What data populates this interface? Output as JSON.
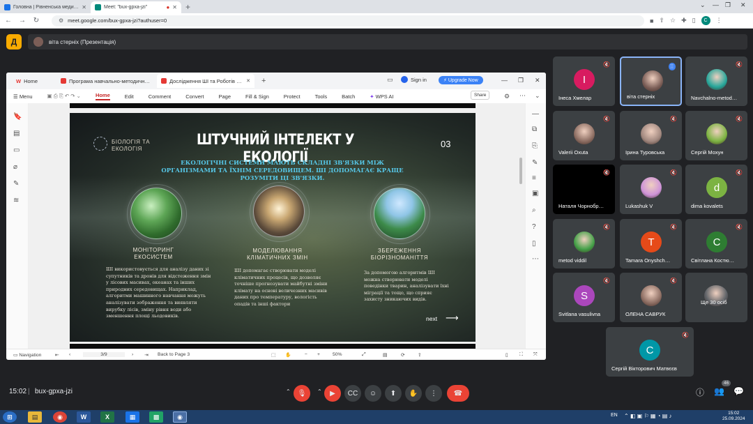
{
  "browser": {
    "tabs": [
      {
        "title": "Головна | Рівненська медична ака…",
        "favicon_color": "#1a73e8"
      },
      {
        "title": "Meet: \"bux-gpxa-jzi\"",
        "favicon_color": "#00897b"
      }
    ],
    "new_tab": "+",
    "url": "meet.google.com/bux-gpxa-jzi?authuser=0",
    "profile_initial": "C"
  },
  "meet": {
    "logo_letter": "Д",
    "presenter_label": "віта стерніх (Презентація)",
    "time": "15:02",
    "meeting_code": "bux-gpxa-jzi",
    "participant_count": "46",
    "participants": [
      {
        "name": "Інеса Хмелар",
        "initial": "І",
        "color": "#d81b60"
      },
      {
        "name": "віта стерніх",
        "initial": "",
        "color": "#7b5e57",
        "highlight": true
      },
      {
        "name": "Navchalno-metod…",
        "initial": "",
        "color": "#26a69a"
      },
      {
        "name": "Valerii Oxuta",
        "initial": "",
        "color": "#8d6e63"
      },
      {
        "name": "Ірина Туровська",
        "initial": "",
        "color": "#a1887f"
      },
      {
        "name": "Сергій Мохун",
        "initial": "",
        "color": "#7cb342"
      },
      {
        "name": "Наталя Чорнобр…",
        "initial": "",
        "color": "#000000"
      },
      {
        "name": "Lukashuk V",
        "initial": "",
        "color": "#ce93d8"
      },
      {
        "name": "dima kovalets",
        "initial": "d",
        "color": "#7cb342"
      },
      {
        "name": "metod viddil",
        "initial": "",
        "color": "#43a047"
      },
      {
        "name": "Tamara Onyshch…",
        "initial": "T",
        "color": "#e64a19"
      },
      {
        "name": "Світлана Костю…",
        "initial": "С",
        "color": "#2e7d32"
      },
      {
        "name": "Svitlana vasulivna",
        "initial": "S",
        "color": "#ab47bc"
      },
      {
        "name": "ОЛЕНА САВРУК",
        "initial": "",
        "color": "#8d6e63"
      },
      {
        "name": "Ще 30 осіб",
        "initial": "",
        "color": "#5f6368"
      },
      {
        "name": "Сергій Вікторович Матвєєв",
        "initial": "С",
        "color": "#0097a7"
      }
    ]
  },
  "wps": {
    "tabs": [
      {
        "title": "Home"
      },
      {
        "title": "Програма навчально-методичного…"
      },
      {
        "title": "Дослідження ШІ та Роботів у…"
      }
    ],
    "signin": "Sign in",
    "upgrade": "Upgrade Now",
    "menu": [
      "Menu",
      "Home",
      "Edit",
      "Comment",
      "Convert",
      "Page",
      "Fill & Sign",
      "Protect",
      "Tools",
      "Batch",
      "WPS AI"
    ],
    "share": "Share",
    "status": {
      "navigation": "Navigation",
      "page": "3/9",
      "back": "Back to Page 3",
      "zoom": "50%"
    }
  },
  "slide": {
    "logo_label": "БІОЛОГІЯ ТА ЕКОЛОГІЯ",
    "title": "ШТУЧНИЙ ІНТЕЛЕКТ У ЕКОЛОГІЇ",
    "number": "03",
    "subtitle": "ЕКОЛОГІЧНІ СИСТЕМИ МАЮТЬ СКЛАДНІ ЗВ'ЯЗКИ МІЖ ОРГАНІЗМАМИ ТА ЇХНІМ СЕРЕДОВИЩЕМ. ШІ ДОПОМАГАЄ КРАЩЕ РОЗУМІТИ ЦІ ЗВ'ЯЗКИ.",
    "sections": [
      {
        "heading": "МОНІТОРИНГ ЕКОСИСТЕМ",
        "text": "ШІ використовується для аналізу даних зі супутників та дронів для відстеження змін у лісових масивах, океанах та інших природних середовищах. Наприклад, алгоритми машинного навчання можуть аналізувати зображення та виявляти вирубку лісів, зміну рівня води або зменшення площі льодовиків."
      },
      {
        "heading": "МОДЕЛЮВАННЯ КЛІМАТИЧНИХ ЗМІН",
        "text": "ШІ допомагає створювати моделі кліматичних процесів, що дозволяє точніше прогнозувати майбутні зміни клімату на основі величезних масивів даних про температуру, вологість опадів та інші фактори"
      },
      {
        "heading": "ЗБЕРЕЖЕННЯ БІОРІЗНОМАНІТТЯ",
        "text": "За допомогою алгоритмів ШІ можна створювати моделі поведінки тварин, аналізувати їхні міграції та тощо, що сприяє захисту зникаючих видів."
      }
    ],
    "next": "next"
  },
  "taskbar": {
    "time": "15:02",
    "date": "25.09.2024",
    "lang": "EN"
  }
}
